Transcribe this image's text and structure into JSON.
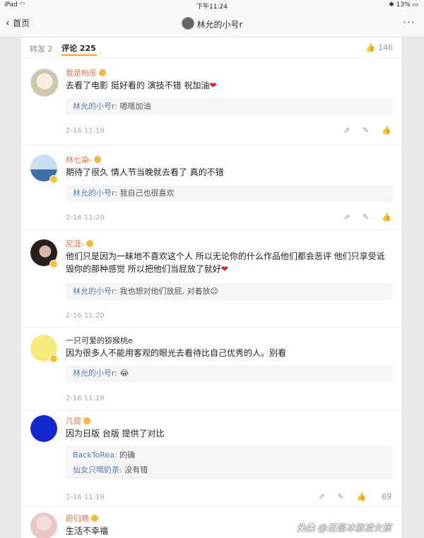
{
  "status": {
    "device": "iPad",
    "wifi": "wifi-icon",
    "time": "下午11:24",
    "battery": "13%"
  },
  "nav": {
    "back_label": "首页",
    "title": "林允的小号r",
    "more": "···"
  },
  "tabs": {
    "repost": "转发 2",
    "comments": "评论 225",
    "likes": "146"
  },
  "comments": [
    {
      "name": "我是柏彤",
      "text": "去看了电影 挺好看的 演技不错 祝加油",
      "emoji": "❤",
      "reply": {
        "who": "林允的小号r:",
        "text": " 嗯嗯加油"
      },
      "time": "2-16 11:19"
    },
    {
      "name": "林七染-",
      "text": "期待了很久 情人节当晚就去看了 真的不错",
      "reply": {
        "who": "林允的小号r:",
        "text": " 我自己也很喜欢"
      },
      "time": "2-16 11:20"
    },
    {
      "name": "尼涯-",
      "text": "他们只是因为一昧地不喜欢这个人 所以无论你的什么作品他们都会恶评 他们只享受诋毁你的那种感觉 所以把他们当屁放了就好",
      "emoji": "❤",
      "reply": {
        "who": "林允的小号r:",
        "text": " 我也想对他们放屁, 对着放",
        "emoji": "😊"
      },
      "time": "2-16 11:20"
    },
    {
      "name": "一只可爱的猕猴桃e",
      "text": "因为很多人不能用客观的眼光去看待比自己优秀的人。别看",
      "reply": {
        "who": "林允的小号r:",
        "text": " ",
        "emoji": "😂"
      },
      "time": "2-16 11:19"
    },
    {
      "name": "几提",
      "text": "因为日版 台版 提供了对比",
      "replies": [
        {
          "who": "BackToRea:",
          "text": " 的确"
        },
        {
          "who": "仙女只喝奶茶:",
          "text": " 没有错"
        }
      ],
      "time": "2-16 11:19",
      "likes": "69"
    },
    {
      "name": "蔚归晚",
      "text": "生活不幸福"
    }
  ],
  "watermark": {
    "source": "头条",
    "author": "@还是冰激凌女孩"
  }
}
